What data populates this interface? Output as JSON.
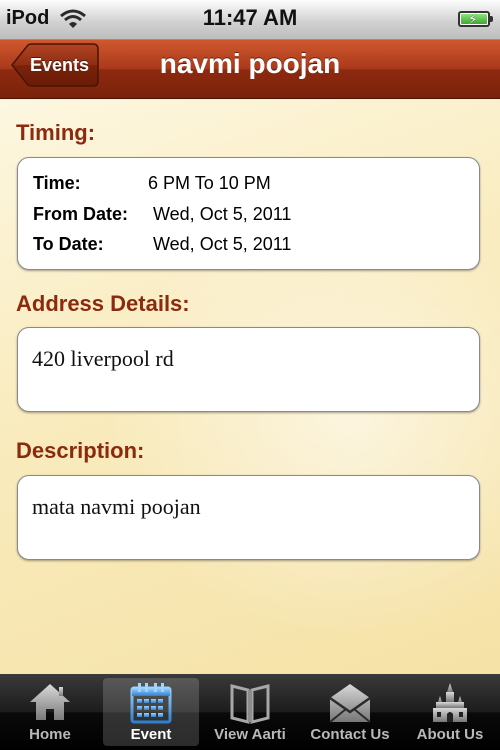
{
  "status_bar": {
    "carrier": "iPod",
    "time": "11:47 AM"
  },
  "nav": {
    "back_label": "Events",
    "title": "navmi poojan"
  },
  "timing": {
    "title": "Timing:",
    "rows": [
      {
        "key": "Time:",
        "value": "6 PM To 10 PM"
      },
      {
        "key": "From Date:",
        "value": "Wed, Oct 5, 2011"
      },
      {
        "key": "To Date:",
        "value": "Wed, Oct 5, 2011"
      }
    ]
  },
  "address": {
    "title": "Address Details:",
    "value": "420 liverpool rd"
  },
  "description": {
    "title": "Description:",
    "value": "mata navmi poojan"
  },
  "tabs": [
    {
      "label": "Home",
      "icon": "home-icon",
      "active": false
    },
    {
      "label": "Event",
      "icon": "calendar-icon",
      "active": true
    },
    {
      "label": "View Aarti",
      "icon": "book-icon",
      "active": false
    },
    {
      "label": "Contact Us",
      "icon": "mail-icon",
      "active": false
    },
    {
      "label": "About Us",
      "icon": "temple-icon",
      "active": false
    }
  ],
  "colors": {
    "nav_bar": "#a8391b",
    "section_title": "#8b2a0e",
    "active_tab_icon": "#5aa9e6"
  }
}
